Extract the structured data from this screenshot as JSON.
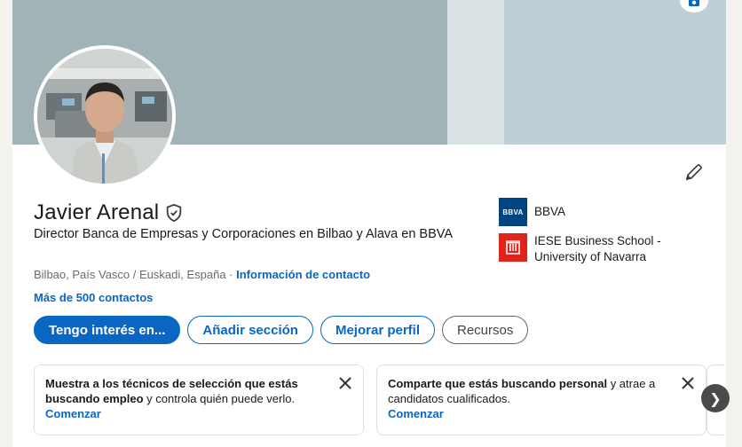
{
  "profile": {
    "name": "Javier Arenal",
    "headline": "Director Banca de Empresas y Corporaciones en Bilbao y Alava en BBVA",
    "location": "Bilbao, País Vasco / Euskadi, España",
    "separator": " · ",
    "contact_info_link": "Información de contacto",
    "connections": "Más de 500 contactos"
  },
  "actions": {
    "interested": "Tengo interés en...",
    "add_section": "Añadir sección",
    "improve_profile": "Mejorar perfil",
    "resources": "Recursos"
  },
  "companies": [
    {
      "name": "BBVA",
      "logo_text": "BBVA",
      "logo_color": "#004481"
    },
    {
      "name": "IESE Business School - University of Navarra",
      "logo_color": "#e2231a"
    }
  ],
  "suggestions": [
    {
      "bold": "Muestra a los técnicos de selección que estás buscando empleo",
      "text": " y controla quién puede verlo.",
      "link": "Comenzar"
    },
    {
      "bold": "Comparte que estás buscando personal",
      "text": " y atrae a candidatos cualificados.",
      "link": "Comenzar"
    }
  ],
  "icons": {
    "edit": "pencil-icon",
    "verified": "shield-check-icon",
    "close": "close-icon",
    "next": "chevron-right-icon",
    "banner_camera": "camera-icon"
  },
  "colors": {
    "brand_blue": "#0a66c2",
    "banner": "#a0b4b7",
    "page_bg": "#f4f2ee"
  }
}
